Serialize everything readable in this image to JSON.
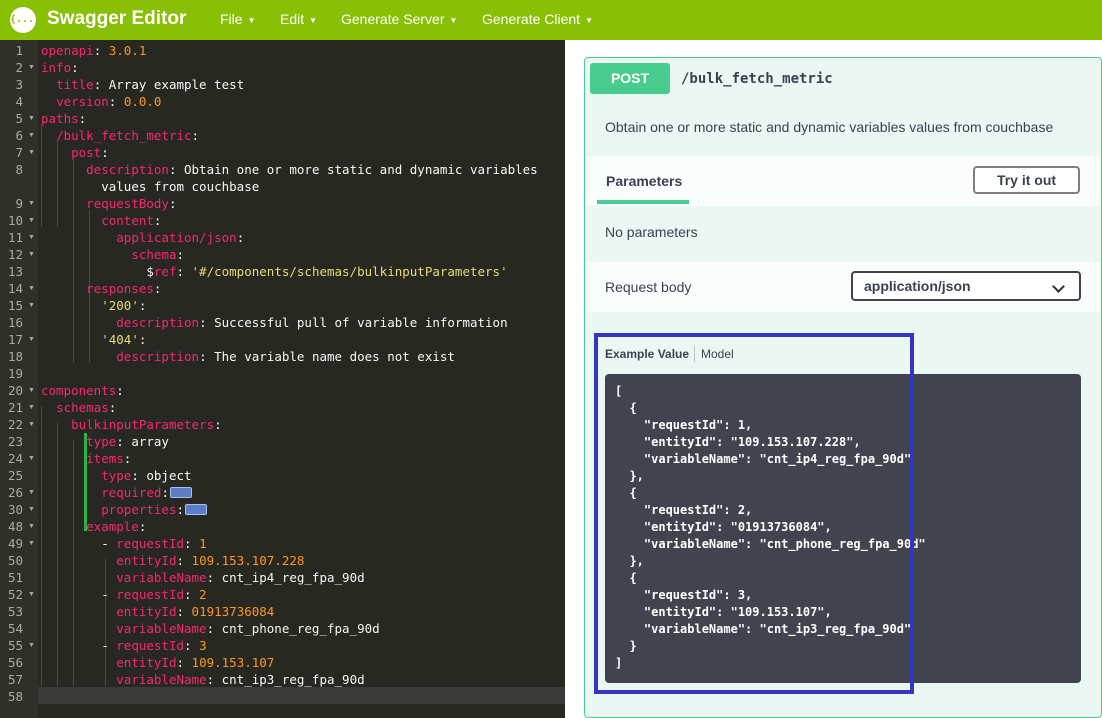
{
  "app": {
    "logo_text": "{...}",
    "title": "Swagger Editor",
    "menus": [
      "File",
      "Edit",
      "Generate Server",
      "Generate Client"
    ]
  },
  "editor": {
    "lines": [
      {
        "n": "1",
        "fold": false,
        "code": "<span class='k'>openapi</span><span class='t'>: </span><span class='n'>3.0.1</span>"
      },
      {
        "n": "2",
        "fold": true,
        "code": "<span class='k'>info</span><span class='t'>:</span>"
      },
      {
        "n": "3",
        "fold": false,
        "code": "  <span class='k'>title</span><span class='t'>: Array example test</span>"
      },
      {
        "n": "4",
        "fold": false,
        "code": "  <span class='k'>version</span><span class='t'>: </span><span class='n'>0.0.0</span>"
      },
      {
        "n": "5",
        "fold": true,
        "code": "<span class='k'>paths</span><span class='t'>:</span>"
      },
      {
        "n": "6",
        "fold": true,
        "code": "  <span class='k'>/bulk_fetch_metric</span><span class='t'>:</span>"
      },
      {
        "n": "7",
        "fold": true,
        "code": "    <span class='k'>post</span><span class='t'>:</span>"
      },
      {
        "n": "8",
        "fold": false,
        "code": "      <span class='k'>description</span><span class='t'>: Obtain one or more static and dynamic variables</span>"
      },
      {
        "n": "",
        "fold": false,
        "code": "        <span class='t'>values from couchbase</span>"
      },
      {
        "n": "9",
        "fold": true,
        "code": "      <span class='k'>requestBody</span><span class='t'>:</span>"
      },
      {
        "n": "10",
        "fold": true,
        "code": "        <span class='k'>content</span><span class='t'>:</span>"
      },
      {
        "n": "11",
        "fold": true,
        "code": "          <span class='k'>application/json</span><span class='t'>:</span>"
      },
      {
        "n": "12",
        "fold": true,
        "code": "            <span class='k'>schema</span><span class='t'>:</span>"
      },
      {
        "n": "13",
        "fold": false,
        "code": "              <span class='t'>$</span><span class='k'>ref</span><span class='t'>: </span><span class='s'>'#/components/schemas/bulkinputParameters'</span>"
      },
      {
        "n": "14",
        "fold": true,
        "code": "      <span class='k'>responses</span><span class='t'>:</span>"
      },
      {
        "n": "15",
        "fold": true,
        "code": "        <span class='s'>'200'</span><span class='t'>:</span>"
      },
      {
        "n": "16",
        "fold": false,
        "code": "          <span class='k'>description</span><span class='t'>: Successful pull of variable information</span>"
      },
      {
        "n": "17",
        "fold": true,
        "code": "        <span class='s'>'404'</span><span class='t'>:</span>"
      },
      {
        "n": "18",
        "fold": false,
        "code": "          <span class='k'>description</span><span class='t'>: The variable name does not exist</span>"
      },
      {
        "n": "19",
        "fold": false,
        "code": ""
      },
      {
        "n": "20",
        "fold": true,
        "code": "<span class='k'>components</span><span class='t'>:</span>"
      },
      {
        "n": "21",
        "fold": true,
        "code": "  <span class='k'>schemas</span><span class='t'>:</span>"
      },
      {
        "n": "22",
        "fold": true,
        "code": "    <span class='k'>bulkinputParameters</span><span class='t'>:</span>"
      },
      {
        "n": "23",
        "fold": false,
        "code": "      <span class='k'>type</span><span class='t'>: array</span>"
      },
      {
        "n": "24",
        "fold": true,
        "code": "      <span class='k'>items</span><span class='t'>:</span>"
      },
      {
        "n": "25",
        "fold": false,
        "code": "        <span class='k'>type</span><span class='t'>: object</span>"
      },
      {
        "n": "26",
        "fold": true,
        "code": "        <span class='k'>required</span><span class='t'>:</span><span class='fw'></span>"
      },
      {
        "n": "30",
        "fold": true,
        "code": "        <span class='k'>properties</span><span class='t'>:</span><span class='fw'></span>"
      },
      {
        "n": "48",
        "fold": true,
        "code": "      <span class='k'>example</span><span class='t'>:</span>"
      },
      {
        "n": "49",
        "fold": true,
        "code": "        <span class='t'>- </span><span class='k'>requestId</span><span class='t'>: </span><span class='n'>1</span>"
      },
      {
        "n": "50",
        "fold": false,
        "code": "          <span class='k'>entityId</span><span class='t'>: </span><span class='n'>109.153.107.228</span>"
      },
      {
        "n": "51",
        "fold": false,
        "code": "          <span class='k'>variableName</span><span class='t'>: cnt_ip4_reg_fpa_90d</span>"
      },
      {
        "n": "52",
        "fold": true,
        "code": "        <span class='t'>- </span><span class='k'>requestId</span><span class='t'>: </span><span class='n'>2</span>"
      },
      {
        "n": "53",
        "fold": false,
        "code": "          <span class='k'>entityId</span><span class='t'>: </span><span class='n'>01913736084</span>"
      },
      {
        "n": "54",
        "fold": false,
        "code": "          <span class='k'>variableName</span><span class='t'>: cnt_phone_reg_fpa_90d</span>"
      },
      {
        "n": "55",
        "fold": true,
        "code": "        <span class='t'>- </span><span class='k'>requestId</span><span class='t'>: </span><span class='n'>3</span>"
      },
      {
        "n": "56",
        "fold": false,
        "code": "          <span class='k'>entityId</span><span class='t'>: </span><span class='n'>109.153.107</span>"
      },
      {
        "n": "57",
        "fold": false,
        "code": "          <span class='k'>variableName</span><span class='t'>: cnt_ip3_reg_fpa_90d</span>"
      },
      {
        "n": "58",
        "fold": false,
        "code": ""
      }
    ]
  },
  "operation": {
    "method": "POST",
    "path": "/bulk_fetch_metric",
    "description": "Obtain one or more static and dynamic variables values from couchbase",
    "parameters_tab": "Parameters",
    "try_it_out": "Try it out",
    "no_parameters": "No parameters",
    "request_body_label": "Request body",
    "content_type": "application/json",
    "example_value_tab": "Example Value",
    "model_tab": "Model",
    "example_json": "[\n  {\n    \"requestId\": 1,\n    \"entityId\": \"109.153.107.228\",\n    \"variableName\": \"cnt_ip4_reg_fpa_90d\"\n  },\n  {\n    \"requestId\": 2,\n    \"entityId\": \"01913736084\",\n    \"variableName\": \"cnt_phone_reg_fpa_90d\"\n  },\n  {\n    \"requestId\": 3,\n    \"entityId\": \"109.153.107\",\n    \"variableName\": \"cnt_ip3_reg_fpa_90d\"\n  }\n]"
  },
  "colors": {
    "topbar": "#89bf04",
    "post": "#49cc90",
    "highlight": "#3535c0"
  }
}
